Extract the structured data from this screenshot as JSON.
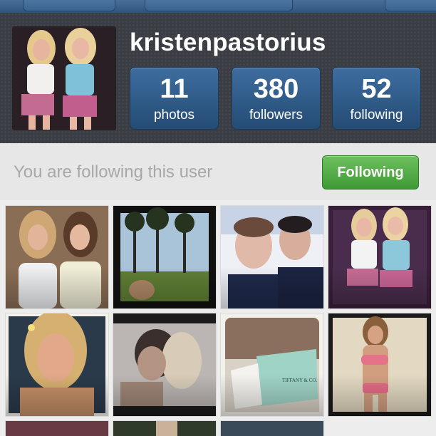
{
  "profile": {
    "username": "kristenpastorius",
    "stats": [
      {
        "value": "11",
        "label": "photos"
      },
      {
        "value": "380",
        "label": "followers"
      },
      {
        "value": "52",
        "label": "following"
      }
    ]
  },
  "follow": {
    "status_text": "You are following this user",
    "button_label": "Following",
    "button_color": "#4fae45"
  },
  "photos": [
    {
      "name": "photo-two-girls-indoors"
    },
    {
      "name": "photo-palm-trees"
    },
    {
      "name": "photo-two-men"
    },
    {
      "name": "photo-two-girls-night"
    },
    {
      "name": "photo-girl-portrait"
    },
    {
      "name": "photo-kiss"
    },
    {
      "name": "photo-tiffany-box"
    },
    {
      "name": "photo-bikini-beach"
    }
  ]
}
